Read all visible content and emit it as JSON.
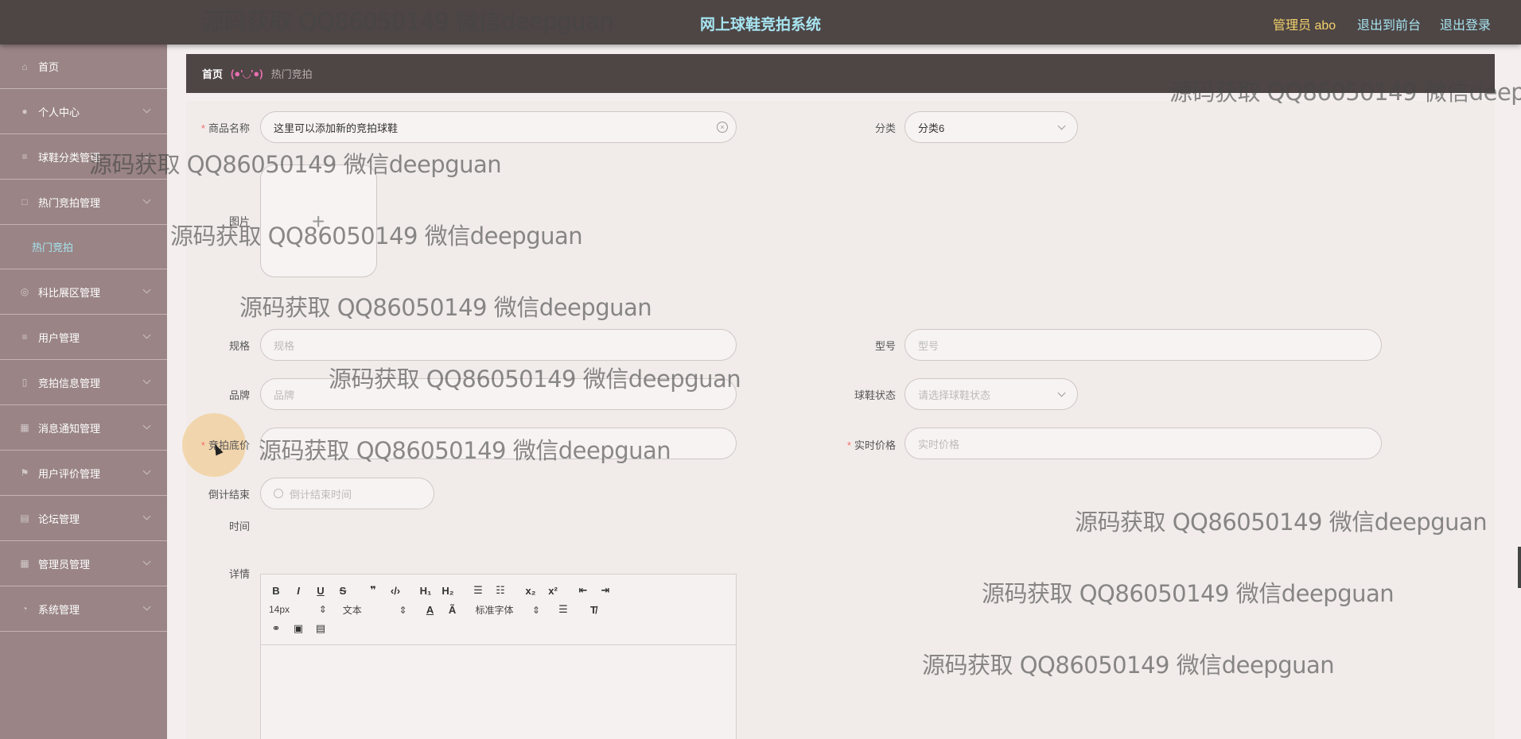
{
  "header": {
    "title": "网上球鞋竞拍系统",
    "admin": "管理员 abo",
    "front": "退出到前台",
    "logout": "退出登录"
  },
  "sidebar": {
    "items": [
      {
        "label": "首页",
        "icon": "home-icon"
      },
      {
        "label": "个人中心",
        "icon": "user-icon"
      },
      {
        "label": "球鞋分类管理",
        "icon": "list-icon"
      },
      {
        "label": "热门竞拍管理",
        "icon": "auction-icon"
      },
      {
        "label": "科比展区管理",
        "icon": "gallery-icon"
      },
      {
        "label": "用户管理",
        "icon": "list-icon"
      },
      {
        "label": "竞拍信息管理",
        "icon": "info-icon"
      },
      {
        "label": "消息通知管理",
        "icon": "message-icon"
      },
      {
        "label": "用户评价管理",
        "icon": "flag-icon"
      },
      {
        "label": "论坛管理",
        "icon": "forum-icon"
      },
      {
        "label": "管理员管理",
        "icon": "admin-icon"
      },
      {
        "label": "系统管理",
        "icon": "settings-icon"
      }
    ],
    "sub_item": "热门竞拍"
  },
  "breadcrumb": {
    "home": "首页",
    "face": "(●'◡'●)",
    "current": "热门竞拍"
  },
  "form": {
    "name_label": "商品名称",
    "name_value": "这里可以添加新的竞拍球鞋",
    "category_label": "分类",
    "category_value": "分类6",
    "image_label": "图片",
    "spec_label": "规格",
    "spec_placeholder": "规格",
    "model_label": "型号",
    "model_placeholder": "型号",
    "brand_label": "品牌",
    "brand_placeholder": "品牌",
    "status_label": "球鞋状态",
    "status_placeholder": "请选择球鞋状态",
    "base_price_label": "竞拍底价",
    "realtime_price_label": "实时价格",
    "realtime_price_placeholder": "实时价格",
    "countdown_label_1": "倒计结束",
    "countdown_label_2": "时间",
    "countdown_placeholder": "倒计结束时间",
    "detail_label": "详情"
  },
  "editor": {
    "font_size": "14px",
    "paragraph": "文本",
    "font_family": "标准字体"
  },
  "watermark": "源码获取 QQ86050149 微信deepguan",
  "colors": {
    "topbar": "#4e4545",
    "sidebar": "#9a8485",
    "title": "#a6e4f0",
    "admin": "#f2d26b",
    "face": "#e86fb0"
  }
}
